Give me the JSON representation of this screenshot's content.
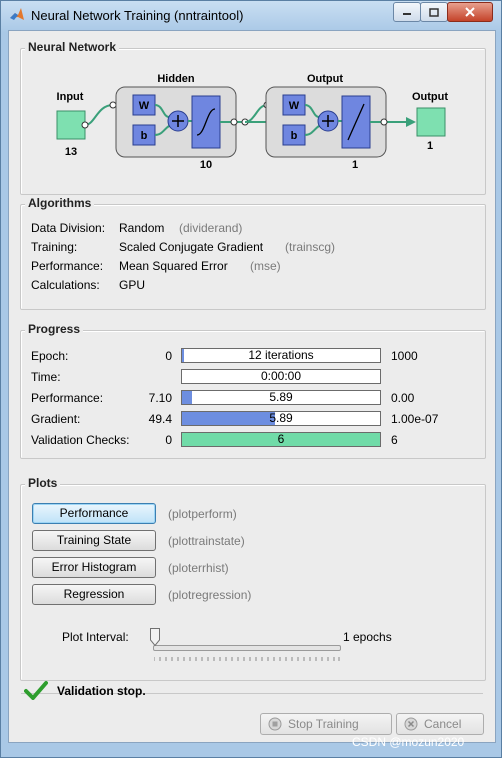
{
  "window": {
    "title": "Neural Network Training (nntraintool)"
  },
  "network": {
    "section_title": "Neural Network",
    "input_label": "Input",
    "input_size": "13",
    "hidden_label": "Hidden",
    "hidden_size": "10",
    "output_layer_label": "Output",
    "output_layer_size": "1",
    "output_label": "Output",
    "output_size": "1",
    "weight_symbol": "W",
    "bias_symbol": "b"
  },
  "algorithms": {
    "section_title": "Algorithms",
    "rows": [
      {
        "label": "Data Division:",
        "value": "Random",
        "fn": "(dividerand)"
      },
      {
        "label": "Training:",
        "value": "Scaled Conjugate Gradient",
        "fn": "(trainscg)"
      },
      {
        "label": "Performance:",
        "value": "Mean Squared Error",
        "fn": "(mse)"
      },
      {
        "label": "Calculations:",
        "value": "GPU",
        "fn": ""
      }
    ]
  },
  "progress": {
    "section_title": "Progress",
    "rows": [
      {
        "label": "Epoch:",
        "start": "0",
        "bar_text": "12 iterations",
        "end": "1000",
        "fraction": 0.012
      },
      {
        "label": "Time:",
        "start": "",
        "bar_text": "0:00:00",
        "end": "",
        "fraction": 0
      },
      {
        "label": "Performance:",
        "start": "7.10",
        "bar_text": "5.89",
        "end": "0.00",
        "fraction": 0.05
      },
      {
        "label": "Gradient:",
        "start": "49.4",
        "bar_text": "5.89",
        "end": "1.00e-07",
        "fraction": 0.47
      },
      {
        "label": "Validation Checks:",
        "start": "0",
        "bar_text": "6",
        "end": "6",
        "fraction": 1.0
      }
    ]
  },
  "plots": {
    "section_title": "Plots",
    "items": [
      {
        "label": "Performance",
        "fn": "(plotperform)"
      },
      {
        "label": "Training State",
        "fn": "(plottrainstate)"
      },
      {
        "label": "Error Histogram",
        "fn": "(ploterrhist)"
      },
      {
        "label": "Regression",
        "fn": "(plotregression)"
      }
    ],
    "interval_label": "Plot Interval:",
    "interval_value": "1 epochs"
  },
  "status": {
    "message": "Validation stop."
  },
  "buttons": {
    "stop_label": "Stop Training",
    "cancel_label": "Cancel"
  },
  "watermark": "CSDN @mozun2020",
  "colors": {
    "accent_blue": "#6d8ee0",
    "accent_green": "#70dba8",
    "node_green": "#7ee0b0",
    "layer_blue": "#6f86e0"
  }
}
